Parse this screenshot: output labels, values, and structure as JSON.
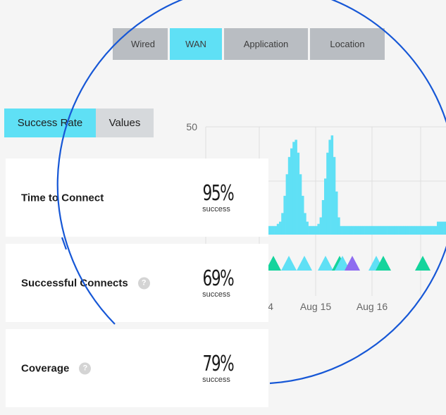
{
  "tabs": [
    {
      "label": "Wired",
      "active": false
    },
    {
      "label": "WAN",
      "active": true
    },
    {
      "label": "Application",
      "active": false
    },
    {
      "label": "Location",
      "active": false
    }
  ],
  "view_toggle": {
    "success_rate": "Success Rate",
    "values": "Values",
    "selected": "Success Rate"
  },
  "chart_data": {
    "type": "area",
    "y_tick_labels": [
      "50"
    ],
    "x_tick_labels": [
      "4",
      "Aug 15",
      "Aug 16"
    ],
    "colors": {
      "area": "#5fe0f5",
      "event_teal": "#14d49c",
      "event_cyan": "#5fe0f5",
      "event_purple": "#8e6cf0"
    },
    "grid": true,
    "series": [
      {
        "values": [
          4,
          4,
          4,
          4,
          5,
          6,
          10,
          18,
          28,
          36,
          40,
          43,
          44,
          38,
          28,
          18,
          10,
          6,
          4,
          4,
          4,
          4,
          5,
          8,
          16,
          26,
          38,
          44,
          46,
          36,
          20,
          8,
          4,
          4,
          4,
          4,
          4,
          4,
          4,
          4,
          4,
          4,
          4,
          4,
          4,
          4,
          4,
          4,
          4,
          4,
          4,
          4,
          4,
          4,
          4,
          4,
          4,
          4,
          4,
          4,
          4,
          4,
          4,
          4,
          4,
          4,
          4,
          4,
          4,
          4,
          4,
          4,
          4,
          4,
          4,
          6,
          6,
          6,
          6,
          6
        ]
      }
    ],
    "events": [
      "teal",
      "cyan",
      "cyan",
      "cyan",
      "teal",
      "cyan",
      "purple",
      "cyan",
      "teal",
      "teal",
      "teal",
      "teal"
    ]
  },
  "cards": [
    {
      "label": "Time to Connect",
      "value": "95%",
      "unit": "success",
      "help": false
    },
    {
      "label": "Successful Connects",
      "value": "69%",
      "unit": "success",
      "help": true,
      "help_glyph": "?"
    },
    {
      "label": "Coverage",
      "value": "79%",
      "unit": "success",
      "help": true,
      "help_glyph": "?"
    }
  ],
  "overlay": {
    "circle_color": "#1657d6"
  }
}
